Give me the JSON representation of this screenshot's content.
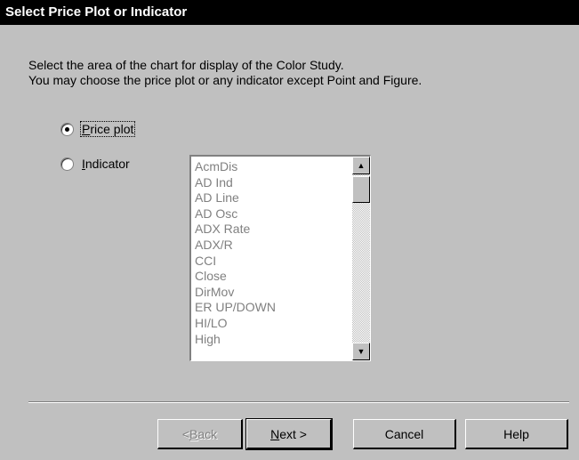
{
  "window": {
    "title": "Select Price Plot or Indicator"
  },
  "instructions": {
    "line1": "Select the area of the chart for display of the Color Study.",
    "line2": "You may choose the price plot or any indicator except Point and Figure."
  },
  "options": {
    "price_plot": {
      "label_u": "P",
      "label_rest": "rice plot",
      "checked": true
    },
    "indicator": {
      "label_u": "I",
      "label_rest": "ndicator",
      "checked": false
    }
  },
  "indicator_list": {
    "items": [
      "AcmDis",
      "AD Ind",
      "AD Line",
      "AD Osc",
      "ADX Rate",
      "ADX/R",
      "CCI",
      "Close",
      "DirMov",
      "ER UP/DOWN",
      "HI/LO",
      "High"
    ]
  },
  "buttons": {
    "back": {
      "pre": "< ",
      "u": "B",
      "post": "ack"
    },
    "next": {
      "u": "N",
      "post": "ext >"
    },
    "cancel": "Cancel",
    "help": "Help"
  },
  "icons": {
    "scroll_up": "up-arrow-icon",
    "scroll_down": "down-arrow-icon"
  }
}
